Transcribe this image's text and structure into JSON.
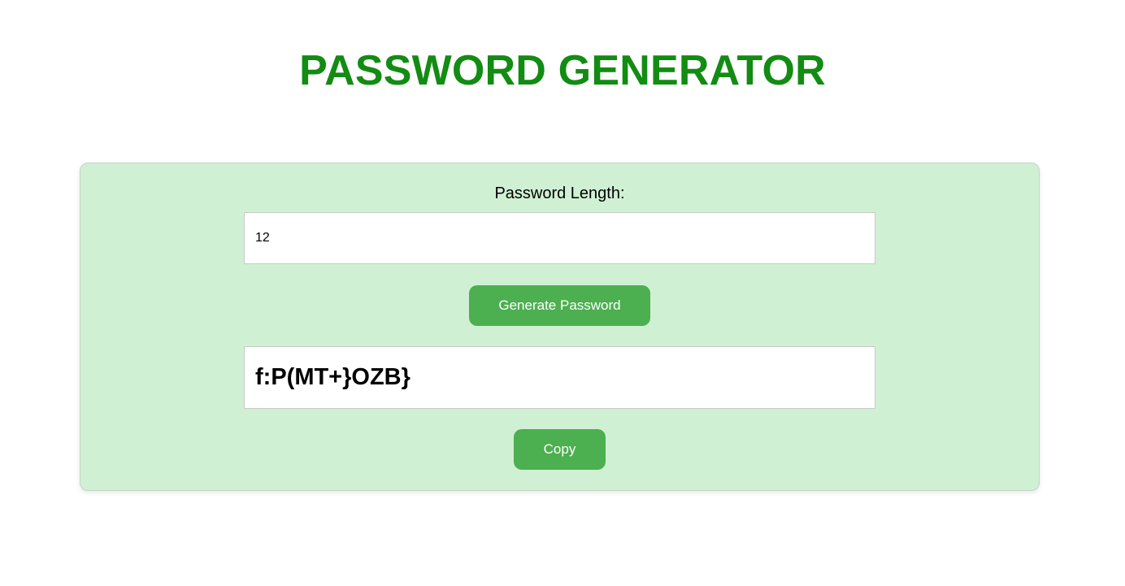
{
  "page": {
    "title": "PASSWORD GENERATOR"
  },
  "form": {
    "length_label": "Password Length:",
    "length_value": "12",
    "generate_label": "Generate Password",
    "password_output": "f:P(MT+}OZB}",
    "copy_label": "Copy"
  },
  "colors": {
    "title": "#128c12",
    "card_background": "#d0f0d4",
    "button": "#4caf50",
    "button_text": "#ffffff"
  }
}
